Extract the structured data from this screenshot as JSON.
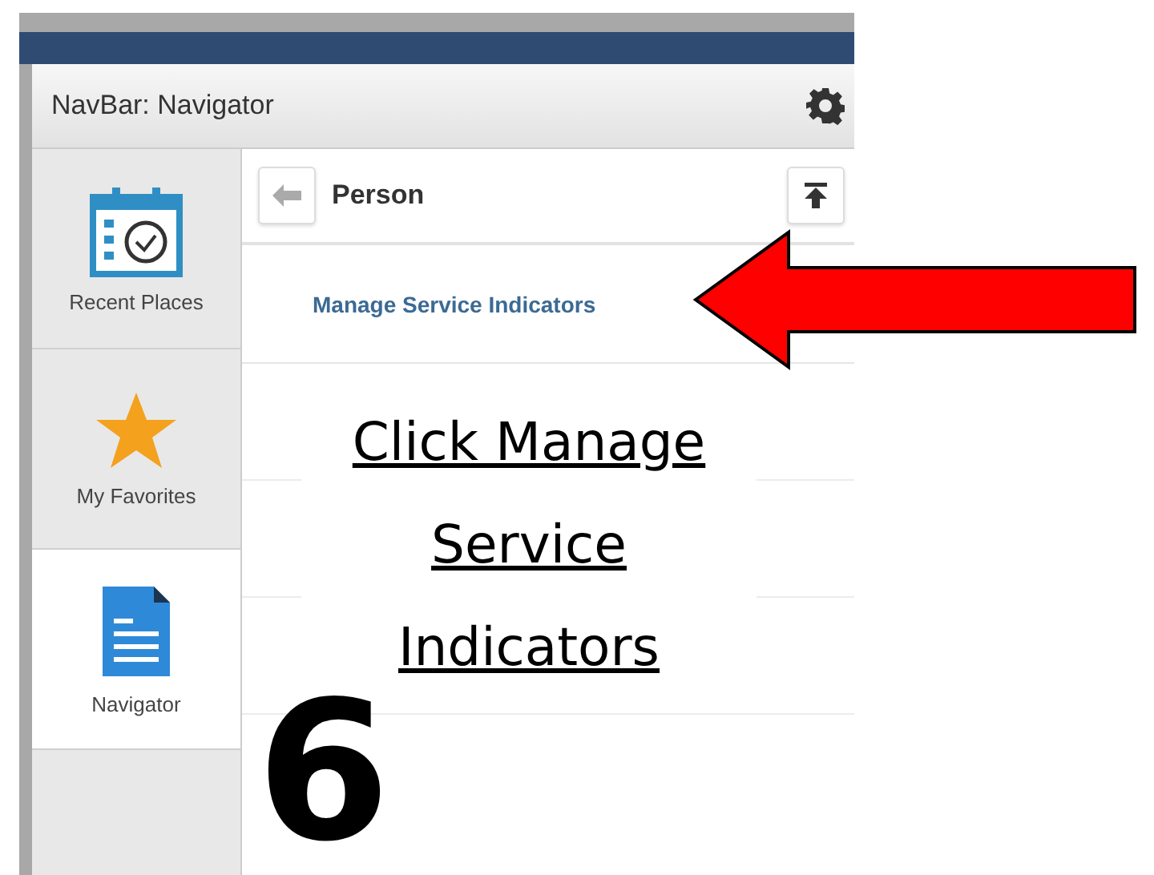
{
  "navbar": {
    "title": "NavBar: Navigator"
  },
  "sidebar": {
    "items": [
      {
        "label": "Recent Places",
        "selected": false,
        "kind": "recent"
      },
      {
        "label": "My Favorites",
        "selected": false,
        "kind": "favorites"
      },
      {
        "label": "Navigator",
        "selected": true,
        "kind": "navigator"
      }
    ]
  },
  "breadcrumb": {
    "title": "Person"
  },
  "menu_items": [
    "Manage Service Indicators"
  ],
  "annotation": {
    "instruction": "Click Manage Service Indicators",
    "step_number": "6"
  }
}
